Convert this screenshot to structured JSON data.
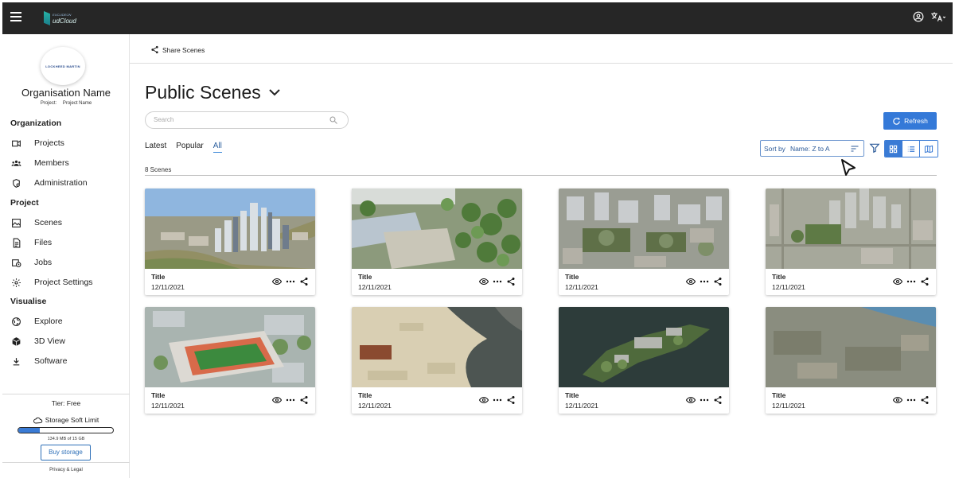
{
  "app": {
    "logo_text": "udCloud",
    "logo_sub": "EUCLIDEON"
  },
  "topbar": {
    "account_icon": "account-circle-icon",
    "language_icon": "translate-icon"
  },
  "sidebar": {
    "logo_text": "LOCKHEED MARTIN",
    "org_name": "Organisation Name",
    "project_label": "Project:",
    "project_name": "Project Name",
    "sections": [
      {
        "title": "Organization",
        "items": [
          {
            "label": "Projects",
            "icon": "projects-icon"
          },
          {
            "label": "Members",
            "icon": "members-icon"
          },
          {
            "label": "Administration",
            "icon": "administration-icon"
          }
        ]
      },
      {
        "title": "Project",
        "items": [
          {
            "label": "Scenes",
            "icon": "scenes-icon"
          },
          {
            "label": "Files",
            "icon": "files-icon"
          },
          {
            "label": "Jobs",
            "icon": "jobs-icon"
          },
          {
            "label": "Project Settings",
            "icon": "gear-icon"
          }
        ]
      },
      {
        "title": "Visualise",
        "items": [
          {
            "label": "Explore",
            "icon": "globe-icon"
          },
          {
            "label": "3D View",
            "icon": "cube-icon"
          },
          {
            "label": "Software",
            "icon": "download-icon"
          }
        ]
      }
    ],
    "tier": "Tier: Free",
    "storage_label": "Storage Soft Limit",
    "storage_used_fraction": 0.23,
    "storage_usage": "134.9 MB of 15 GB",
    "buy_storage": "Buy storage",
    "privacy": "Privacy & Legal"
  },
  "main": {
    "share_scenes": "Share Scenes",
    "title": "Public Scenes",
    "search_placeholder": "Search",
    "refresh": "Refresh",
    "tabs": [
      {
        "label": "Latest",
        "active": false
      },
      {
        "label": "Popular",
        "active": false
      },
      {
        "label": "All",
        "active": true
      }
    ],
    "sort_label": "Sort by",
    "sort_value": "Name: Z to A",
    "view_modes": [
      "grid",
      "list",
      "map"
    ],
    "active_view": "grid",
    "count": "8 Scenes",
    "scenes": [
      {
        "title": "Title",
        "date": "12/11/2021",
        "thumb": "city-skyline-river"
      },
      {
        "title": "Title",
        "date": "12/11/2021",
        "thumb": "park-aerial"
      },
      {
        "title": "Title",
        "date": "12/11/2021",
        "thumb": "downtown-aerial"
      },
      {
        "title": "Title",
        "date": "12/11/2021",
        "thumb": "city-grid-aerial"
      },
      {
        "title": "Title",
        "date": "12/11/2021",
        "thumb": "stadium-aerial"
      },
      {
        "title": "Title",
        "date": "12/11/2021",
        "thumb": "quarry-water"
      },
      {
        "title": "Title",
        "date": "12/11/2021",
        "thumb": "island-prison"
      },
      {
        "title": "Title",
        "date": "12/11/2021",
        "thumb": "coastline-terrain"
      }
    ]
  }
}
